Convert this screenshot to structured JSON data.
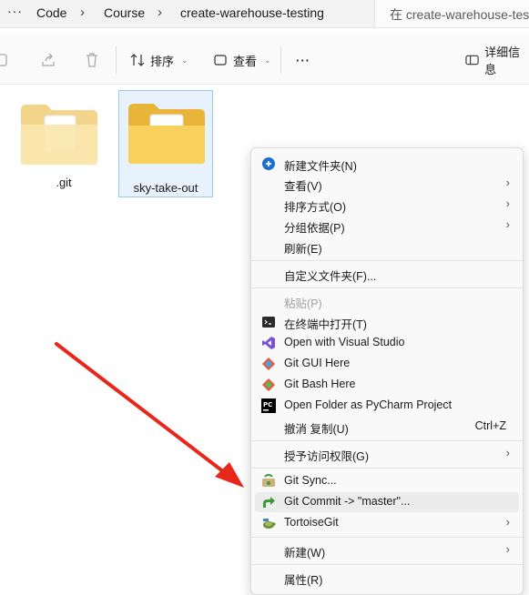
{
  "breadcrumb": {
    "ellipsis": "···",
    "items": [
      "Code",
      "Course",
      "create-warehouse-testing"
    ],
    "separator": "›"
  },
  "search": {
    "placeholder": "在 create-warehouse-testi"
  },
  "toolbar": {
    "sort_label": "排序",
    "view_label": "查看",
    "more_label": "···",
    "details_label": "详细信息"
  },
  "folders": [
    {
      "name": ".git",
      "selected": false
    },
    {
      "name": "sky-take-out",
      "selected": true
    }
  ],
  "context_menu": {
    "items": [
      {
        "label": "新建文件夹(N)",
        "icon": "new-folder-icon"
      },
      {
        "label": "查看(V)",
        "submenu": true
      },
      {
        "label": "排序方式(O)",
        "submenu": true
      },
      {
        "label": "分组依据(P)",
        "submenu": true
      },
      {
        "label": "刷新(E)"
      },
      {
        "label": "自定义文件夹(F)..."
      },
      {
        "label": "粘贴(P)",
        "disabled": true
      },
      {
        "label": "在终端中打开(T)",
        "icon": "terminal-icon"
      },
      {
        "label": "Open with Visual Studio",
        "icon": "visual-studio-icon"
      },
      {
        "label": "Git GUI Here",
        "icon": "git-gui-icon"
      },
      {
        "label": "Git Bash Here",
        "icon": "git-bash-icon"
      },
      {
        "label": "Open Folder as PyCharm Project",
        "icon": "pycharm-icon"
      },
      {
        "label": "撤消 复制(U)",
        "shortcut": "Ctrl+Z"
      },
      {
        "label": "授予访问权限(G)",
        "submenu": true
      },
      {
        "label": "Git Sync...",
        "icon": "git-sync-icon"
      },
      {
        "label": "Git Commit -> \"master\"...",
        "icon": "git-commit-icon",
        "highlighted": true
      },
      {
        "label": "TortoiseGit",
        "icon": "tortoisegit-icon",
        "submenu": true
      },
      {
        "label": "新建(W)",
        "submenu": true
      },
      {
        "label": "属性(R)"
      }
    ],
    "submenu_arrow": "›"
  },
  "colors": {
    "accent": "#0067c0",
    "annotation_arrow": "#e8261a",
    "folder_yellow": "#f8d775",
    "selection_bg": "#e8f2fd"
  }
}
